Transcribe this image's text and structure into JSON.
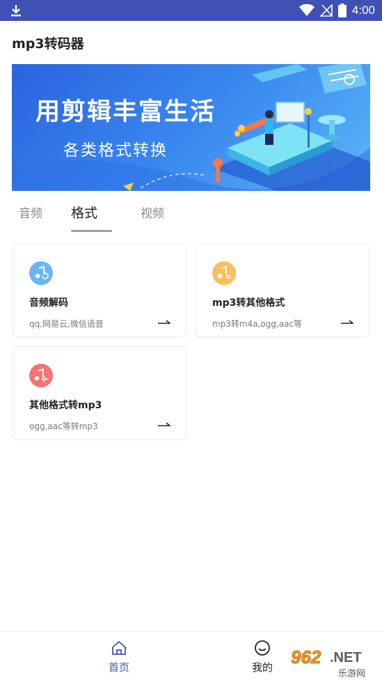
{
  "status_bar": {
    "time": "4:00",
    "download_icon": "download-icon",
    "wifi_icon": "wifi-icon",
    "signal_icon": "signal-off-icon",
    "battery_icon": "battery-icon",
    "bg_color": "#3F51B5"
  },
  "header": {
    "title": "mp3转码器"
  },
  "banner": {
    "headline": "用剪辑丰富生活",
    "subline": "各类格式转换"
  },
  "tabs": [
    {
      "label": "音频",
      "active": false
    },
    {
      "label": "格式",
      "active": true
    },
    {
      "label": "视频",
      "active": false
    }
  ],
  "cards": [
    {
      "title": "音频解码",
      "subtitle": "qq,网易云,微信语音",
      "icon": "music-refresh-icon",
      "icon_color": "#5AA7F2"
    },
    {
      "title": "mp3转其他格式",
      "subtitle": "mp3转m4a,ogg,aac等",
      "icon": "music-list-icon",
      "icon_color": "#F7B955"
    },
    {
      "title": "其他格式转mp3",
      "subtitle": "ogg,aac等转mp3",
      "icon": "music-wave-icon",
      "icon_color": "#F16B6B"
    }
  ],
  "bottom_nav": [
    {
      "label": "首页",
      "icon": "home-icon",
      "active": true,
      "color": "#3F51B5"
    },
    {
      "label": "我的",
      "icon": "smiley-icon",
      "active": false,
      "color": "#222222"
    }
  ],
  "watermark": {
    "brand": "962.NET",
    "caption": "乐游网"
  }
}
